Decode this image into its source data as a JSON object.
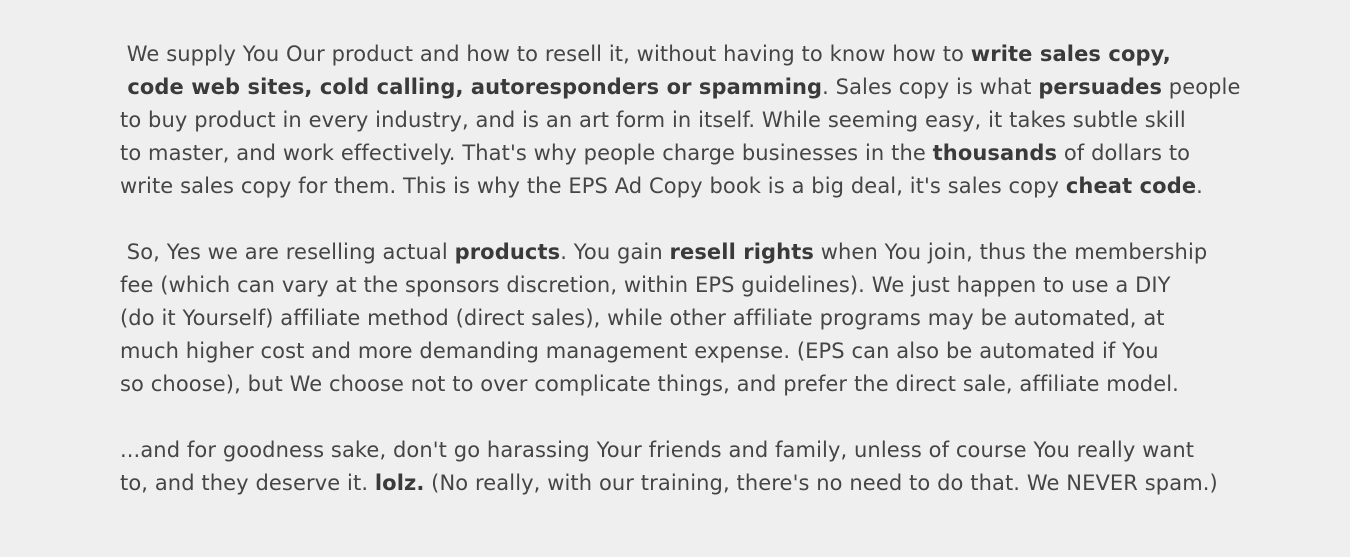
{
  "paragraphs": [
    {
      "lines": [
        [
          {
            "t": " We supply You Our product and how to resell it, without having to know how to ",
            "b": false
          },
          {
            "t": "write sales copy,",
            "b": true
          }
        ],
        [
          {
            "t": " code web sites, cold calling, autoresponders or spamming",
            "b": true
          },
          {
            "t": ". Sales copy is what ",
            "b": false
          },
          {
            "t": "persuades",
            "b": true
          },
          {
            "t": " people",
            "b": false
          }
        ],
        [
          {
            "t": "to buy product in every industry, and is an art form in itself. While seeming easy, it takes subtle skill",
            "b": false
          }
        ],
        [
          {
            "t": "to master, and work effectively. That's why people charge businesses in the ",
            "b": false
          },
          {
            "t": "thousands",
            "b": true
          },
          {
            "t": " of dollars to",
            "b": false
          }
        ],
        [
          {
            "t": "write sales copy for them. This is why the EPS Ad Copy book is a big deal, it's sales copy ",
            "b": false
          },
          {
            "t": "cheat code",
            "b": true
          },
          {
            "t": ".",
            "b": false
          }
        ]
      ]
    },
    {
      "lines": [
        [
          {
            "t": " So, Yes we are reselling actual ",
            "b": false
          },
          {
            "t": "products",
            "b": true
          },
          {
            "t": ". You gain ",
            "b": false
          },
          {
            "t": "resell rights",
            "b": true
          },
          {
            "t": " when You join, thus the membership",
            "b": false
          }
        ],
        [
          {
            "t": "fee (which can vary at the sponsors discretion, within EPS guidelines). We just happen to use a DIY",
            "b": false
          }
        ],
        [
          {
            "t": "(do it Yourself) affiliate method (direct sales), while other affiliate programs may be automated, at",
            "b": false
          }
        ],
        [
          {
            "t": "much higher cost and more demanding management expense. (EPS can also be automated if You",
            "b": false
          }
        ],
        [
          {
            "t": "so choose), but We choose not to over complicate things, and prefer the direct sale, affiliate model.",
            "b": false
          }
        ]
      ]
    },
    {
      "lines": [
        [
          {
            "t": "...and for goodness sake, don't go harassing Your friends and family, unless of course You really want",
            "b": false
          }
        ],
        [
          {
            "t": "to, and they deserve it. ",
            "b": false
          },
          {
            "t": "lolz.",
            "b": true
          },
          {
            "t": " (No really, with our training, there's no need to do that. We NEVER spam.)",
            "b": false
          }
        ]
      ]
    }
  ]
}
